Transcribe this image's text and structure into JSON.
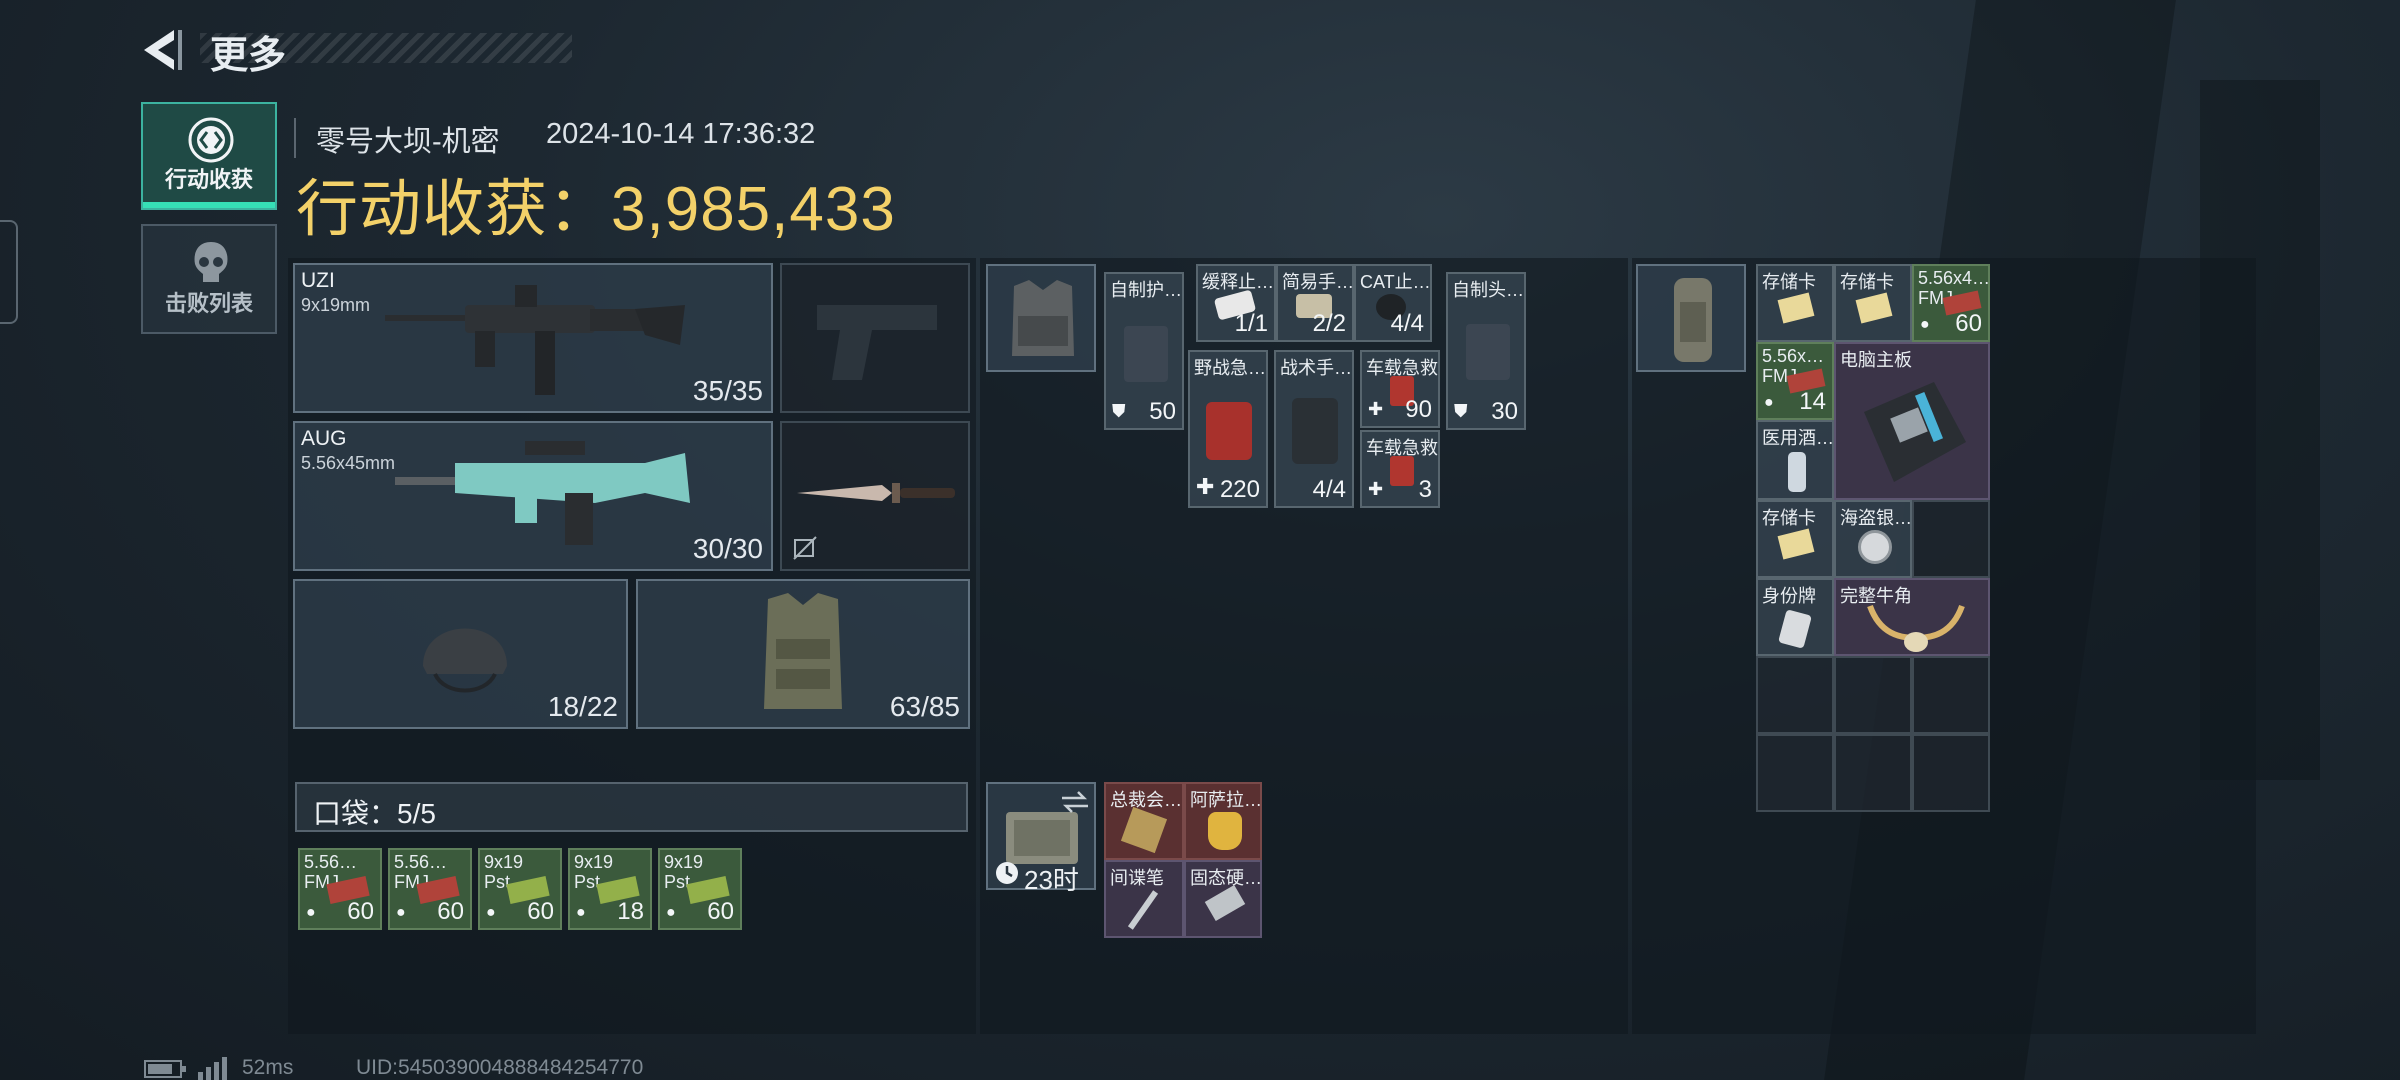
{
  "header": {
    "title": "更多"
  },
  "tabs": [
    {
      "label": "行动收获",
      "active": true
    },
    {
      "label": "击败列表",
      "active": false
    }
  ],
  "info": {
    "map_name": "零号大坝-机密",
    "timestamp": "2024-10-14 17:36:32",
    "harvest_label": "行动收获：",
    "harvest_value": "3,985,433"
  },
  "loadout": {
    "primary": {
      "name": "UZI",
      "caliber": "9x19mm",
      "ammo": "35/35"
    },
    "secondary": {
      "name": "AUG",
      "caliber": "5.56x45mm",
      "ammo": "30/30"
    },
    "helmet": {
      "durability": "18/22"
    },
    "armor": {
      "durability": "63/85"
    },
    "pocket_label": "口袋：5/5",
    "pocket_items": [
      {
        "name": "5.56…",
        "sub": "FMJ",
        "qty": "60"
      },
      {
        "name": "5.56…",
        "sub": "FMJ",
        "qty": "60"
      },
      {
        "name": "9x19",
        "sub": "Pst",
        "qty": "60"
      },
      {
        "name": "9x19",
        "sub": "Pst",
        "qty": "18"
      },
      {
        "name": "9x19",
        "sub": "Pst",
        "qty": "60"
      }
    ]
  },
  "rig": {
    "items": [
      {
        "name": "自制护…",
        "qty": "50"
      },
      {
        "name": "缓释止…",
        "qty": "1/1"
      },
      {
        "name": "简易手…",
        "qty": "2/2"
      },
      {
        "name": "CAT止…",
        "qty": "4/4"
      },
      {
        "name": "自制头…",
        "qty": "30"
      },
      {
        "name": "野战急…",
        "qty": "220"
      },
      {
        "name": "战术手…",
        "qty": "4/4"
      },
      {
        "name": "车载急救…",
        "qty": "90"
      },
      {
        "name": "车载急救…",
        "qty": "3"
      }
    ],
    "safebox_time": "23时",
    "safebox_items": [
      {
        "name": "总裁会…"
      },
      {
        "name": "阿萨拉…"
      },
      {
        "name": "间谍笔"
      },
      {
        "name": "固态硬…"
      }
    ]
  },
  "backpack": {
    "items": [
      {
        "name": "存储卡"
      },
      {
        "name": "存储卡"
      },
      {
        "name": "5.56x4…",
        "sub": "FMJ",
        "qty": "60"
      },
      {
        "name": "5.56x…",
        "sub": "FMJ",
        "qty": "14"
      },
      {
        "name": "电脑主板"
      },
      {
        "name": "医用酒…"
      },
      {
        "name": "存储卡"
      },
      {
        "name": "海盗银…"
      },
      {
        "name": "身份牌"
      },
      {
        "name": "完整牛角"
      }
    ]
  },
  "footer": {
    "ping": "52ms",
    "uid": "UID:545039004888484254770"
  }
}
